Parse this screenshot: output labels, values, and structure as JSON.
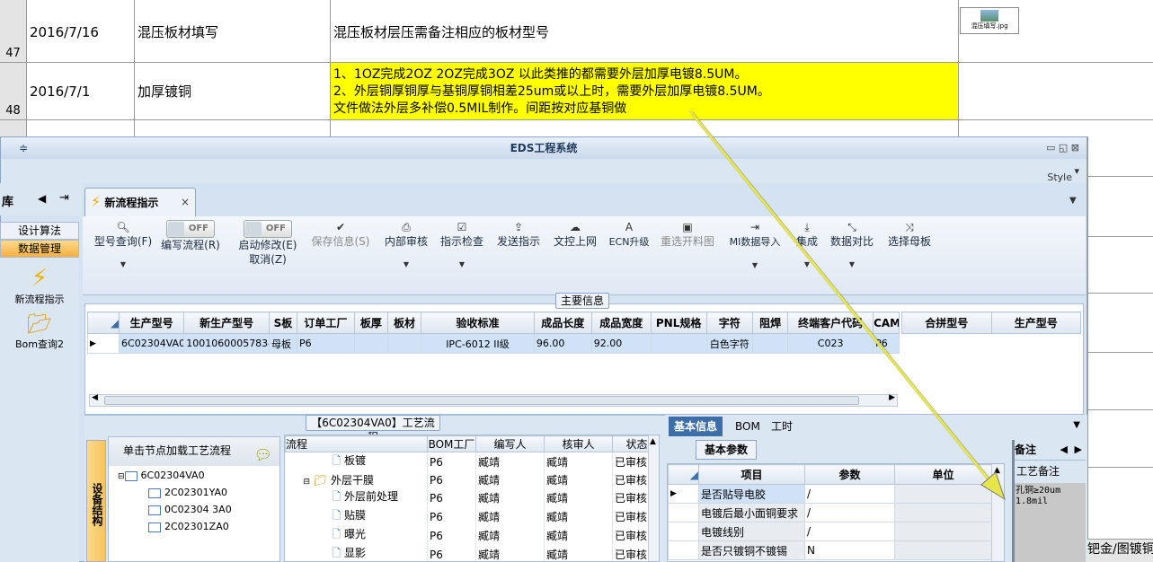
{
  "sheet": {
    "row_top": "47",
    "rows": [
      {
        "num": "47",
        "date": "2016/7/16",
        "title": "混压板材填写",
        "desc": "混压板材层压需备注相应的板材型号",
        "attachment": "混压填写.jpg"
      },
      {
        "num": "48",
        "date": "2016/7/1",
        "title": "加厚镀铜",
        "desc_lines": [
          "1、1OZ完成2OZ 2OZ完成3OZ 以此类推的都需要外层加厚电镀8.5UM。",
          "2、外层铜厚铜厚与基铜厚铜相差25um或以上时，需要外层加厚电镀8.5UM。",
          "文件做法外层多补偿0.5MIL制作。间距按对应基铜做"
        ]
      }
    ],
    "bottom_right_text": "钯金/图镀铜"
  },
  "window": {
    "title": "EDS工程系统",
    "style_label": "Style",
    "left_header": "库",
    "tab_label": "新流程指示"
  },
  "ribbon": {
    "buttons": [
      {
        "label": "型号查询(F)",
        "icon": "search-icon"
      },
      {
        "label": "编写流程(R)",
        "toggle": "OFF"
      },
      {
        "label": "启动修改(E)",
        "label2": "取消(Z)",
        "toggle": "OFF"
      },
      {
        "label": "保存信息(S)",
        "icon": "check-icon",
        "disabled": true
      },
      {
        "label": "内部审核",
        "icon": "print-icon"
      },
      {
        "label": "指示检查",
        "icon": "checkbox-icon"
      },
      {
        "label": "发送指示",
        "icon": "upload-icon"
      },
      {
        "label": "文控上网",
        "icon": "cloud-upload-icon"
      },
      {
        "label": "ECN升级",
        "icon": "font-icon"
      },
      {
        "label": "重选开料图",
        "icon": "image-icon",
        "disabled": true
      },
      {
        "label": "MI数据导入",
        "icon": "import-icon"
      },
      {
        "label": "集成",
        "icon": "download-icon"
      },
      {
        "label": "数据对比",
        "icon": "compare-icon"
      },
      {
        "label": "选择母板",
        "icon": "shuffle-icon"
      }
    ]
  },
  "nav": {
    "items": [
      "设计算法",
      "数据管理"
    ],
    "icons": [
      {
        "label": "新流程指示",
        "icon": "lightning-icon"
      },
      {
        "label": "Bom查询2",
        "icon": "folder-icon"
      }
    ]
  },
  "main_grid": {
    "group_title": "主要信息",
    "columns": [
      "生产型号",
      "新生产型号",
      "S板",
      "订单工厂",
      "板厚",
      "板材",
      "验收标准",
      "成品长度",
      "成品宽度",
      "PNL规格",
      "字符",
      "阻焊",
      "终端客户代码",
      "CAM工"
    ],
    "row": [
      "6C02304VA0",
      "10010600057834",
      "母板",
      "P6",
      "",
      "",
      "IPC-6012 II级",
      "96.00",
      "92.00",
      "",
      "白色字符",
      "",
      "C023",
      "P6"
    ]
  },
  "side_grid": {
    "columns": [
      "合拼型号",
      "生产型号"
    ]
  },
  "process": {
    "title": "【6C02304VA0】工艺流程",
    "vertical_tab": "设备结构",
    "tree_header": "单击节点加载工艺流程",
    "tree_root": "6C02304VA0",
    "tree_children": [
      "2C02301YA0",
      "0C02304 3A0",
      "2C02301ZA0"
    ],
    "columns": [
      "流程",
      "BOM工厂",
      "编写人",
      "核审人",
      "状态"
    ],
    "rows": [
      {
        "name": "板镀",
        "factory": "P6",
        "writer": "臧靖",
        "reviewer": "臧靖",
        "status": "已审核"
      },
      {
        "name": "外层干膜",
        "factory": "P6",
        "writer": "臧靖",
        "reviewer": "臧靖",
        "status": "已审核"
      },
      {
        "name": "外层前处理",
        "factory": "P6",
        "writer": "臧靖",
        "reviewer": "臧靖",
        "status": "已审核"
      },
      {
        "name": "贴膜",
        "factory": "P6",
        "writer": "臧靖",
        "reviewer": "臧靖",
        "status": "已审核"
      },
      {
        "name": "曝光",
        "factory": "P6",
        "writer": "臧靖",
        "reviewer": "臧靖",
        "status": "已审核"
      },
      {
        "name": "显影",
        "factory": "P6",
        "writer": "臧靖",
        "reviewer": "臧靖",
        "status": "已审核"
      }
    ]
  },
  "params": {
    "tabs": [
      "基本信息",
      "BOM",
      "工时"
    ],
    "subtab": "基本参数",
    "columns": [
      "项目",
      "参数",
      "单位"
    ],
    "rows": [
      {
        "item": "是否贴导电胶",
        "value": "/",
        "unit": ""
      },
      {
        "item": "电镀后最小面铜要求",
        "value": "/",
        "unit": ""
      },
      {
        "item": "电镀线别",
        "value": "/",
        "unit": ""
      },
      {
        "item": "是否只镀铜不镀锡",
        "value": "N",
        "unit": ""
      }
    ]
  },
  "notes": {
    "tab": "备注",
    "header": "工艺备注",
    "lines": [
      "孔铜≥20um",
      "1.8mil"
    ]
  },
  "colors": {
    "highlight": "#ffff00",
    "arrow": "#d4d43a",
    "accent": "#3d6ea8"
  }
}
